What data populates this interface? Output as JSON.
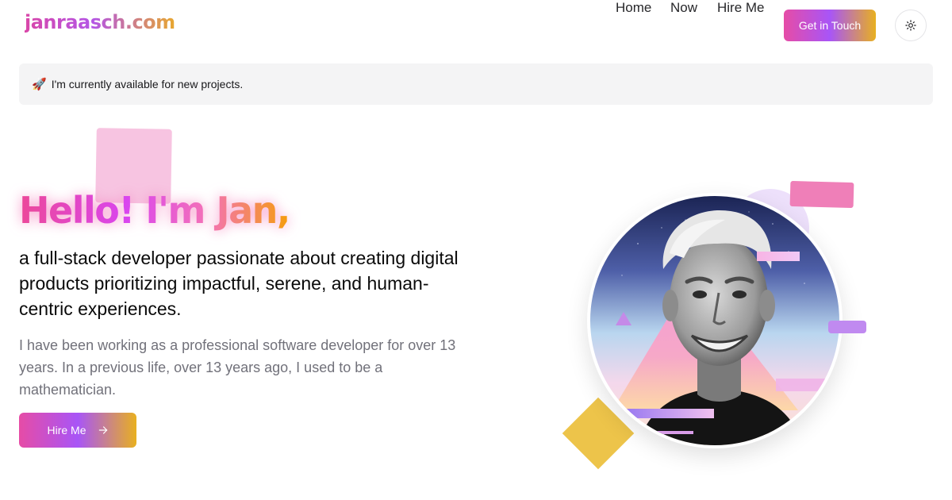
{
  "header": {
    "logo": "janraasch.com",
    "nav": {
      "home": "Home",
      "now": "Now",
      "hire_me": "Hire Me"
    },
    "cta_label": "Get in Touch",
    "theme_toggle_icon": "sun-icon"
  },
  "banner": {
    "icon": "rocket-icon",
    "text": "I'm currently available for new projects."
  },
  "hero": {
    "title": "Hello! I'm Jan,",
    "subtitle": "a full-stack developer passionate about creating digital products prioritizing impactful, serene, and human-centric experiences.",
    "body": "I have been working as a professional software developer for over 13 years. In a previous life, over 13 years ago, I used to be a mathematician.",
    "button_label": "Hire Me",
    "button_icon": "arrow-right-icon"
  },
  "colors": {
    "gradient_start": "#e64ca6",
    "gradient_mid": "#a855f7",
    "gradient_end": "#e8b020",
    "banner_bg": "#f4f4f5",
    "body_text": "#71717a"
  }
}
